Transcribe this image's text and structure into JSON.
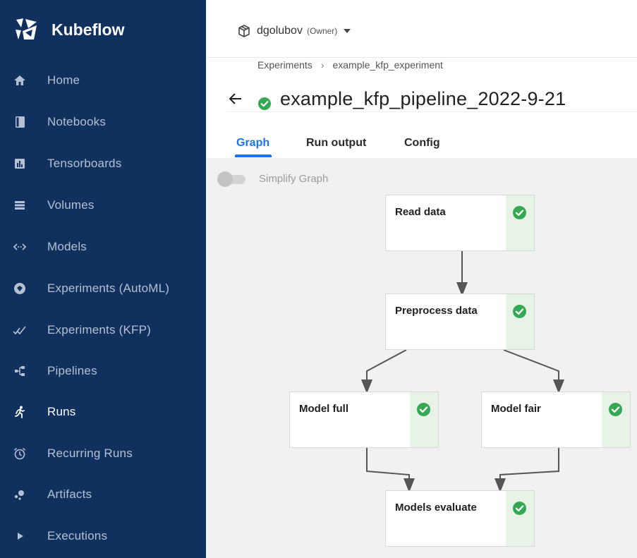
{
  "app": {
    "brand_name": "Kubeflow",
    "colors": {
      "sidebar_bg": "#10315e",
      "accent_blue": "#1a73e8",
      "success_green": "#34a853",
      "node_status_bg": "#e6f3e6"
    }
  },
  "sidebar": {
    "items": [
      {
        "label": "Home",
        "icon": "home-icon"
      },
      {
        "label": "Notebooks",
        "icon": "notebook-icon"
      },
      {
        "label": "Tensorboards",
        "icon": "tensorboard-icon"
      },
      {
        "label": "Volumes",
        "icon": "volumes-icon"
      },
      {
        "label": "Models",
        "icon": "models-icon"
      },
      {
        "label": "Experiments (AutoML)",
        "icon": "automl-icon"
      },
      {
        "label": "Experiments (KFP)",
        "icon": "experiments-kfp-icon"
      },
      {
        "label": "Pipelines",
        "icon": "pipelines-icon"
      },
      {
        "label": "Runs",
        "icon": "runs-icon",
        "active": true
      },
      {
        "label": "Recurring Runs",
        "icon": "alarm-clock-icon"
      },
      {
        "label": "Artifacts",
        "icon": "artifacts-icon"
      },
      {
        "label": "Executions",
        "icon": "play-icon"
      }
    ]
  },
  "namespace": {
    "user": "dgolubov",
    "role": "(Owner)",
    "icon": "cube-icon"
  },
  "breadcrumb": {
    "items": [
      "Experiments",
      "example_kfp_experiment"
    ],
    "separator": "›"
  },
  "run": {
    "title": "example_kfp_pipeline_2022-9-21",
    "status": "succeeded"
  },
  "tabs": [
    {
      "label": "Graph",
      "active": true
    },
    {
      "label": "Run output",
      "active": false
    },
    {
      "label": "Config",
      "active": false
    }
  ],
  "graph": {
    "simplify_label": "Simplify Graph",
    "simplify_enabled": false,
    "nodes": [
      {
        "label": "Read data",
        "status": "succeeded"
      },
      {
        "label": "Preprocess data",
        "status": "succeeded"
      },
      {
        "label": "Model full",
        "status": "succeeded"
      },
      {
        "label": "Model fair",
        "status": "succeeded"
      },
      {
        "label": "Models evaluate",
        "status": "succeeded"
      }
    ],
    "edges": [
      [
        "Read data",
        "Preprocess data"
      ],
      [
        "Preprocess data",
        "Model full"
      ],
      [
        "Preprocess data",
        "Model fair"
      ],
      [
        "Model full",
        "Models evaluate"
      ],
      [
        "Model fair",
        "Models evaluate"
      ]
    ]
  }
}
